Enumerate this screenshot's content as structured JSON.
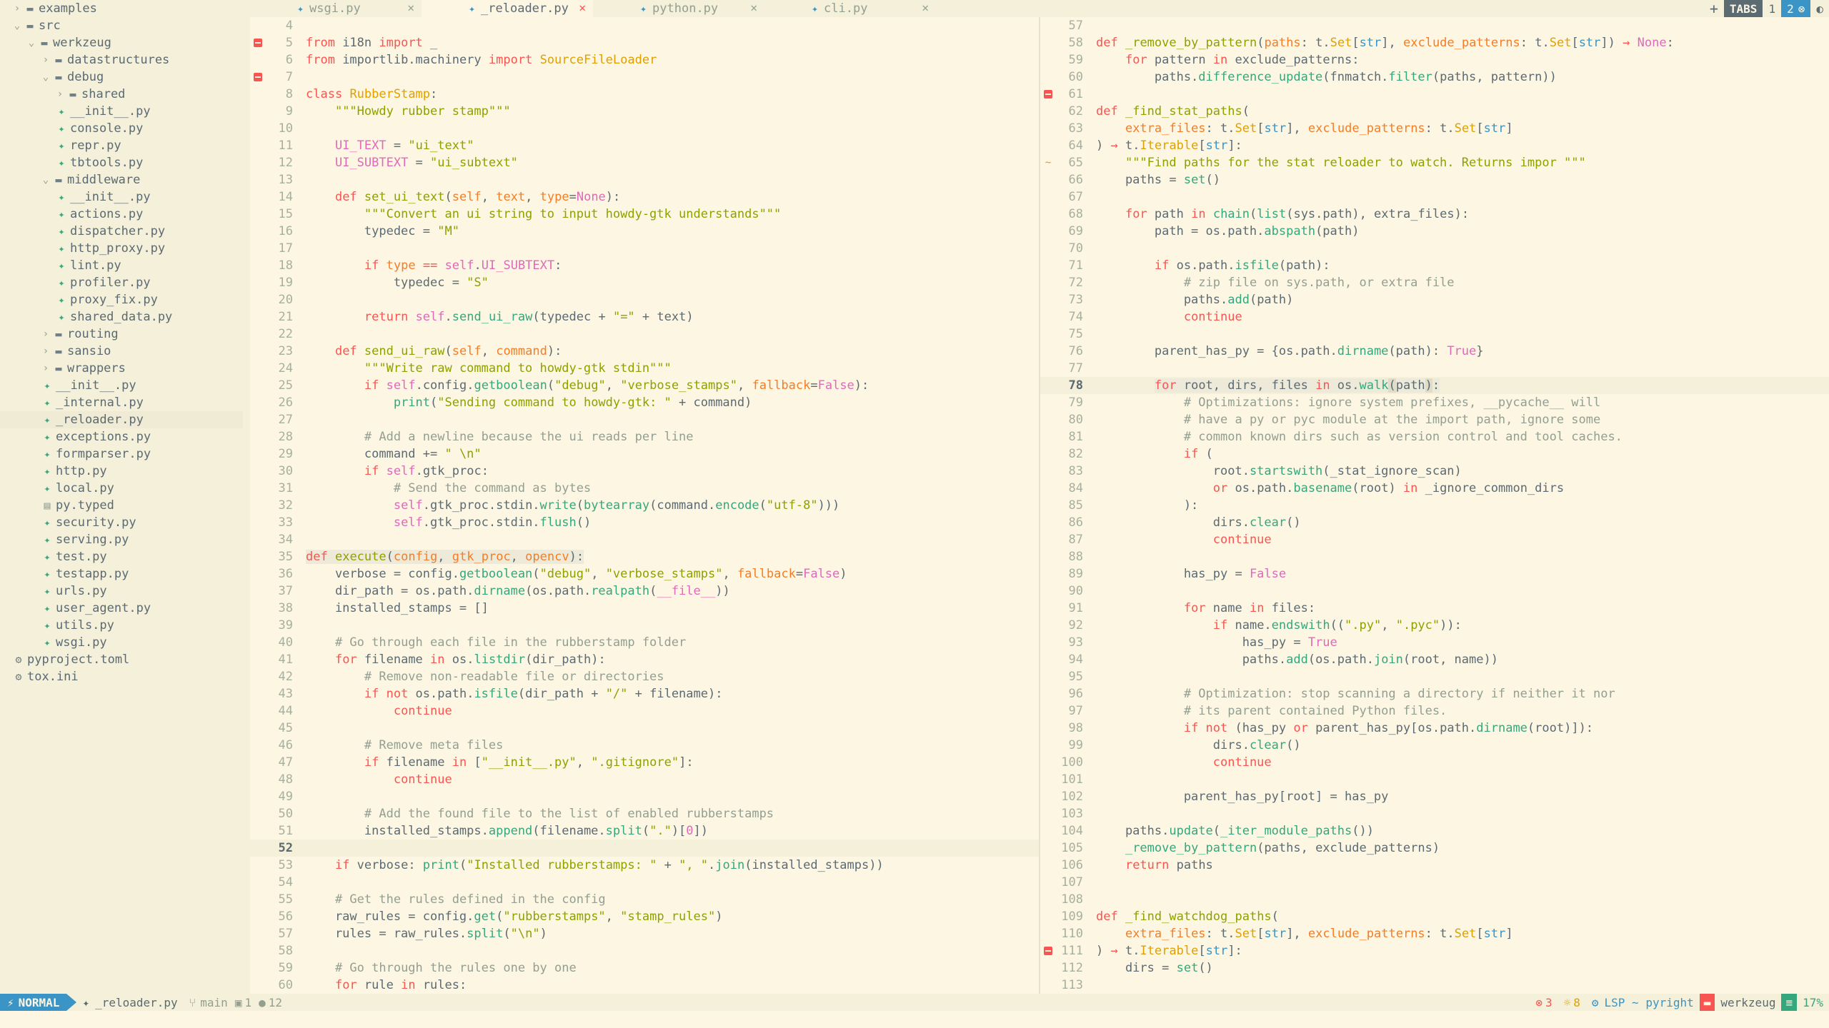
{
  "sidebar": {
    "items": [
      {
        "label": "examples",
        "type": "folder",
        "depth": 0,
        "open": false
      },
      {
        "label": "src",
        "type": "folder",
        "depth": 0,
        "open": true
      },
      {
        "label": "werkzeug",
        "type": "folder",
        "depth": 1,
        "open": true
      },
      {
        "label": "datastructures",
        "type": "folder",
        "depth": 2,
        "open": false
      },
      {
        "label": "debug",
        "type": "folder",
        "depth": 2,
        "open": true
      },
      {
        "label": "shared",
        "type": "folder",
        "depth": 3,
        "open": false
      },
      {
        "label": "__init__.py",
        "type": "py",
        "depth": 3
      },
      {
        "label": "console.py",
        "type": "py",
        "depth": 3
      },
      {
        "label": "repr.py",
        "type": "py",
        "depth": 3
      },
      {
        "label": "tbtools.py",
        "type": "py",
        "depth": 3
      },
      {
        "label": "middleware",
        "type": "folder",
        "depth": 2,
        "open": true
      },
      {
        "label": "__init__.py",
        "type": "py",
        "depth": 3
      },
      {
        "label": "actions.py",
        "type": "py",
        "depth": 3
      },
      {
        "label": "dispatcher.py",
        "type": "py",
        "depth": 3
      },
      {
        "label": "http_proxy.py",
        "type": "py",
        "depth": 3
      },
      {
        "label": "lint.py",
        "type": "py",
        "depth": 3
      },
      {
        "label": "profiler.py",
        "type": "py",
        "depth": 3
      },
      {
        "label": "proxy_fix.py",
        "type": "py",
        "depth": 3
      },
      {
        "label": "shared_data.py",
        "type": "py",
        "depth": 3
      },
      {
        "label": "routing",
        "type": "folder",
        "depth": 2,
        "open": false
      },
      {
        "label": "sansio",
        "type": "folder",
        "depth": 2,
        "open": false
      },
      {
        "label": "wrappers",
        "type": "folder",
        "depth": 2,
        "open": false
      },
      {
        "label": "__init__.py",
        "type": "py",
        "depth": 2
      },
      {
        "label": "_internal.py",
        "type": "py",
        "depth": 2
      },
      {
        "label": "_reloader.py",
        "type": "py",
        "depth": 2,
        "selected": true
      },
      {
        "label": "exceptions.py",
        "type": "py",
        "depth": 2
      },
      {
        "label": "formparser.py",
        "type": "py",
        "depth": 2
      },
      {
        "label": "http.py",
        "type": "py",
        "depth": 2
      },
      {
        "label": "local.py",
        "type": "py",
        "depth": 2
      },
      {
        "label": "py.typed",
        "type": "txt",
        "depth": 2
      },
      {
        "label": "security.py",
        "type": "py",
        "depth": 2
      },
      {
        "label": "serving.py",
        "type": "py",
        "depth": 2
      },
      {
        "label": "test.py",
        "type": "py",
        "depth": 2
      },
      {
        "label": "testapp.py",
        "type": "py",
        "depth": 2
      },
      {
        "label": "urls.py",
        "type": "py",
        "depth": 2
      },
      {
        "label": "user_agent.py",
        "type": "py",
        "depth": 2
      },
      {
        "label": "utils.py",
        "type": "py",
        "depth": 2
      },
      {
        "label": "wsgi.py",
        "type": "py",
        "depth": 2
      },
      {
        "label": "pyproject.toml",
        "type": "cfg",
        "depth": 0
      },
      {
        "label": "tox.ini",
        "type": "cfg",
        "depth": 0
      }
    ]
  },
  "tabs": [
    {
      "label": "wsgi.py",
      "active": false
    },
    {
      "label": "_reloader.py",
      "active": true
    },
    {
      "label": "python.py",
      "active": false
    },
    {
      "label": "cli.py",
      "active": false
    }
  ],
  "tabbar_right": {
    "plus": "+",
    "tabs_label": "TABS",
    "tab1": "1",
    "tab2": "2"
  },
  "icons": {
    "close": "close-icon",
    "python": "python-file-icon",
    "folder": "folder-icon",
    "error_sign": "error-sign-icon"
  },
  "left_pane": {
    "current_line": 52,
    "lines": [
      {
        "n": 4,
        "h": ""
      },
      {
        "n": 5,
        "s": "err",
        "h": "<span class='kw'>from</span> i18n <span class='kw'>import</span> _"
      },
      {
        "n": 6,
        "h": "<span class='kw'>from</span> importlib.machinery <span class='kw'>import</span> <span class='ty'>SourceFileLoader</span>"
      },
      {
        "n": 7,
        "s": "err",
        "h": ""
      },
      {
        "n": 8,
        "h": "<span class='kw'>class</span> <span class='ty'>RubberStamp</span>:"
      },
      {
        "n": 9,
        "h": "    <span class='st'>\"\"\"Howdy rubber stamp\"\"\"</span>"
      },
      {
        "n": 10,
        "h": ""
      },
      {
        "n": 11,
        "h": "    <span class='cn'>UI_TEXT</span> = <span class='st'>\"ui_text\"</span>"
      },
      {
        "n": 12,
        "h": "    <span class='cn'>UI_SUBTEXT</span> = <span class='st'>\"ui_subtext\"</span>"
      },
      {
        "n": 13,
        "h": ""
      },
      {
        "n": 14,
        "h": "    <span class='kw'>def</span> <span class='fd'>set_ui_text</span>(<span class='pr'>self</span>, <span class='pr'>text</span>, <span class='pr'>type</span>=<span class='cn'>None</span>):"
      },
      {
        "n": 15,
        "h": "        <span class='st'>\"\"\"Convert an ui string to input howdy-gtk understands\"\"\"</span>"
      },
      {
        "n": 16,
        "h": "        typedec = <span class='st'>\"M\"</span>"
      },
      {
        "n": 17,
        "h": ""
      },
      {
        "n": 18,
        "h": "        <span class='kw'>if</span> <span class='pr'>type</span> <span class='kw'>==</span> <span class='sf'>self</span>.<span class='cn'>UI_SUBTEXT</span>:"
      },
      {
        "n": 19,
        "h": "            typedec = <span class='st'>\"S\"</span>"
      },
      {
        "n": 20,
        "h": ""
      },
      {
        "n": 21,
        "h": "        <span class='kw'>return</span> <span class='sf'>self</span>.<span class='fn'>send_ui_raw</span>(typedec + <span class='st'>\"=\"</span> + text)"
      },
      {
        "n": 22,
        "h": ""
      },
      {
        "n": 23,
        "h": "    <span class='kw'>def</span> <span class='fd'>send_ui_raw</span>(<span class='pr'>self</span>, <span class='pr'>command</span>):"
      },
      {
        "n": 24,
        "h": "        <span class='st'>\"\"\"Write raw command to howdy-gtk stdin\"\"\"</span>"
      },
      {
        "n": 25,
        "h": "        <span class='kw'>if</span> <span class='sf'>self</span>.config.<span class='fn'>getboolean</span>(<span class='st'>\"debug\"</span>, <span class='st'>\"verbose_stamps\"</span>, <span class='pr'>fallback</span>=<span class='cn'>False</span>):"
      },
      {
        "n": 26,
        "h": "            <span class='fn'>print</span>(<span class='st'>\"Sending command to howdy-gtk: \"</span> + command)"
      },
      {
        "n": 27,
        "h": ""
      },
      {
        "n": 28,
        "h": "        <span class='cm'># Add a newline because the ui reads per line</span>"
      },
      {
        "n": 29,
        "h": "        command += <span class='st'>\" \\n\"</span>"
      },
      {
        "n": 30,
        "h": "        <span class='kw'>if</span> <span class='sf'>self</span>.gtk_proc:"
      },
      {
        "n": 31,
        "h": "            <span class='cm'># Send the command as bytes</span>"
      },
      {
        "n": 32,
        "h": "            <span class='sf'>self</span>.gtk_proc.stdin.<span class='fn'>write</span>(<span class='fn'>bytearray</span>(command.<span class='fn'>encode</span>(<span class='st'>\"utf-8\"</span>)))"
      },
      {
        "n": 33,
        "h": "            <span class='sf'>self</span>.gtk_proc.stdin.<span class='fn'>flush</span>()"
      },
      {
        "n": 34,
        "h": ""
      },
      {
        "n": 35,
        "h": "<span class='hl'><span class='kw'>def</span> <span class='fd'>execute</span>(<span class='pr'>config</span>, <span class='pr'>gtk_proc</span>, <span class='pr'>opencv</span>):</span>"
      },
      {
        "n": 36,
        "h": "    verbose = config.<span class='fn'>getboolean</span>(<span class='st'>\"debug\"</span>, <span class='st'>\"verbose_stamps\"</span>, <span class='pr'>fallback</span>=<span class='cn'>False</span>)"
      },
      {
        "n": 37,
        "h": "    dir_path = os.path.<span class='fn'>dirname</span>(os.path.<span class='fn'>realpath</span>(<span class='cn'>__file__</span>))"
      },
      {
        "n": 38,
        "h": "    installed_stamps = []"
      },
      {
        "n": 39,
        "h": ""
      },
      {
        "n": 40,
        "h": "    <span class='cm'># Go through each file in the rubberstamp folder</span>"
      },
      {
        "n": 41,
        "h": "    <span class='kw'>for</span> filename <span class='kw'>in</span> os.<span class='fn'>listdir</span>(dir_path):"
      },
      {
        "n": 42,
        "h": "        <span class='cm'># Remove non-readable file or directories</span>"
      },
      {
        "n": 43,
        "h": "        <span class='kw'>if not</span> os.path.<span class='fn'>isfile</span>(dir_path + <span class='st'>\"/\"</span> + filename):"
      },
      {
        "n": 44,
        "h": "            <span class='kw'>continue</span>"
      },
      {
        "n": 45,
        "h": ""
      },
      {
        "n": 46,
        "h": "        <span class='cm'># Remove meta files</span>"
      },
      {
        "n": 47,
        "h": "        <span class='kw'>if</span> filename <span class='kw'>in</span> [<span class='st'>\"__init__.py\"</span>, <span class='st'>\".gitignore\"</span>]:"
      },
      {
        "n": 48,
        "h": "            <span class='kw'>continue</span>"
      },
      {
        "n": 49,
        "h": ""
      },
      {
        "n": 50,
        "h": "        <span class='cm'># Add the found file to the list of enabled rubberstamps</span>"
      },
      {
        "n": 51,
        "h": "        installed_stamps.<span class='fn'>append</span>(filename.<span class='fn'>split</span>(<span class='st'>\".\"</span>)[<span class='cn'>0</span>])"
      },
      {
        "n": 52,
        "h": ""
      },
      {
        "n": 53,
        "h": "    <span class='kw'>if</span> verbose: <span class='fn'>print</span>(<span class='st'>\"Installed rubberstamps: \"</span> + <span class='st'>\", \"</span>.<span class='fn'>join</span>(installed_stamps))"
      },
      {
        "n": 54,
        "h": ""
      },
      {
        "n": 55,
        "h": "    <span class='cm'># Get the rules defined in the config</span>"
      },
      {
        "n": 56,
        "h": "    raw_rules = config.<span class='fn'>get</span>(<span class='st'>\"rubberstamps\"</span>, <span class='st'>\"stamp_rules\"</span>)"
      },
      {
        "n": 57,
        "h": "    rules = raw_rules.<span class='fn'>split</span>(<span class='st'>\"\\n\"</span>)"
      },
      {
        "n": 58,
        "h": ""
      },
      {
        "n": 59,
        "h": "    <span class='cm'># Go through the rules one by one</span>"
      },
      {
        "n": 60,
        "h": "    <span class='kw'>for</span> rule <span class='kw'>in</span> rules:"
      }
    ]
  },
  "right_pane": {
    "current_line": 78,
    "lines": [
      {
        "n": 57,
        "h": ""
      },
      {
        "n": 58,
        "h": "<span class='kw'>def</span> <span class='fd'>_remove_by_pattern</span>(<span class='pr'>paths</span>: t.<span class='ty'>Set</span>[<span class='bi'>str</span>], <span class='pr'>exclude_patterns</span>: t.<span class='ty'>Set</span>[<span class='bi'>str</span>]) <span class='kw'>→</span> <span class='cn'>None</span>:"
      },
      {
        "n": 59,
        "h": "    <span class='kw'>for</span> pattern <span class='kw'>in</span> exclude_patterns:"
      },
      {
        "n": 60,
        "h": "        paths.<span class='fn'>difference_update</span>(fnmatch.<span class='fn'>filter</span>(paths, pattern))"
      },
      {
        "n": 61,
        "s": "err",
        "h": ""
      },
      {
        "n": 62,
        "h": "<span class='kw'>def</span> <span class='fd'>_find_stat_paths</span>("
      },
      {
        "n": 63,
        "h": "    <span class='pr'>extra_files</span>: t.<span class='ty'>Set</span>[<span class='bi'>str</span>], <span class='pr'>exclude_patterns</span>: t.<span class='ty'>Set</span>[<span class='bi'>str</span>]"
      },
      {
        "n": 64,
        "h": ") <span class='kw'>→</span> t.<span class='ty'>Iterable</span>[<span class='bi'>str</span>]:"
      },
      {
        "n": 65,
        "s": "mod",
        "h": "    <span class='st'>\"\"\"Find paths for the stat reloader to watch. Returns impor \"\"\"</span>"
      },
      {
        "n": 66,
        "h": "    paths = <span class='fn'>set</span>()"
      },
      {
        "n": 67,
        "h": ""
      },
      {
        "n": 68,
        "h": "    <span class='kw'>for</span> path <span class='kw'>in</span> <span class='fn'>chain</span>(<span class='fn'>list</span>(sys.path), extra_files):"
      },
      {
        "n": 69,
        "h": "        path = os.path.<span class='fn'>abspath</span>(path)"
      },
      {
        "n": 70,
        "h": ""
      },
      {
        "n": 71,
        "h": "        <span class='kw'>if</span> os.path.<span class='fn'>isfile</span>(path):"
      },
      {
        "n": 72,
        "h": "            <span class='cm'># zip file on sys.path, or extra file</span>"
      },
      {
        "n": 73,
        "h": "            paths.<span class='fn'>add</span>(path)"
      },
      {
        "n": 74,
        "h": "            <span class='kw'>continue</span>"
      },
      {
        "n": 75,
        "h": ""
      },
      {
        "n": 76,
        "h": "        parent_has_py = {os.path.<span class='fn'>dirname</span>(path): <span class='cn'>True</span>}"
      },
      {
        "n": 77,
        "h": ""
      },
      {
        "n": 78,
        "h": "        <span class='hl'><span class='kw'>for</span> root, dirs, files <span class='kw'>in</span> os.<span class='fn'>walk</span><span class='sel'>(</span>path<span class='sel'>)</span>:</span>"
      },
      {
        "n": 79,
        "h": "            <span class='cm'># Optimizations: ignore system prefixes, __pycache__ will</span>"
      },
      {
        "n": 80,
        "h": "            <span class='cm'># have a py or pyc module at the import path, ignore some</span>"
      },
      {
        "n": 81,
        "h": "            <span class='cm'># common known dirs such as version control and tool caches.</span>"
      },
      {
        "n": 82,
        "h": "            <span class='kw'>if</span> ("
      },
      {
        "n": 83,
        "h": "                root.<span class='fn'>startswith</span>(_stat_ignore_scan)"
      },
      {
        "n": 84,
        "h": "                <span class='kw'>or</span> os.path.<span class='fn'>basename</span>(root) <span class='kw'>in</span> _ignore_common_dirs"
      },
      {
        "n": 85,
        "h": "            ):"
      },
      {
        "n": 86,
        "h": "                dirs.<span class='fn'>clear</span>()"
      },
      {
        "n": 87,
        "h": "                <span class='kw'>continue</span>"
      },
      {
        "n": 88,
        "h": ""
      },
      {
        "n": 89,
        "h": "            has_py = <span class='cn'>False</span>"
      },
      {
        "n": 90,
        "h": ""
      },
      {
        "n": 91,
        "h": "            <span class='kw'>for</span> name <span class='kw'>in</span> files:"
      },
      {
        "n": 92,
        "h": "                <span class='kw'>if</span> name.<span class='fn'>endswith</span>((<span class='st'>\".py\"</span>, <span class='st'>\".pyc\"</span>)):"
      },
      {
        "n": 93,
        "h": "                    has_py = <span class='cn'>True</span>"
      },
      {
        "n": 94,
        "h": "                    paths.<span class='fn'>add</span>(os.path.<span class='fn'>join</span>(root, name))"
      },
      {
        "n": 95,
        "h": ""
      },
      {
        "n": 96,
        "h": "            <span class='cm'># Optimization: stop scanning a directory if neither it nor</span>"
      },
      {
        "n": 97,
        "h": "            <span class='cm'># its parent contained Python files.</span>"
      },
      {
        "n": 98,
        "h": "            <span class='kw'>if not</span> (has_py <span class='kw'>or</span> parent_has_py[os.path.<span class='fn'>dirname</span>(root)]):"
      },
      {
        "n": 99,
        "h": "                dirs.<span class='fn'>clear</span>()"
      },
      {
        "n": 100,
        "h": "                <span class='kw'>continue</span>"
      },
      {
        "n": 101,
        "h": ""
      },
      {
        "n": 102,
        "h": "            parent_has_py[root] = has_py"
      },
      {
        "n": 103,
        "h": ""
      },
      {
        "n": 104,
        "h": "    paths.<span class='fn'>update</span>(<span class='fn'>_iter_module_paths</span>())"
      },
      {
        "n": 105,
        "h": "    <span class='fn'>_remove_by_pattern</span>(paths, exclude_patterns)"
      },
      {
        "n": 106,
        "h": "    <span class='kw'>return</span> paths"
      },
      {
        "n": 107,
        "h": ""
      },
      {
        "n": 108,
        "h": ""
      },
      {
        "n": 109,
        "h": "<span class='kw'>def</span> <span class='fd'>_find_watchdog_paths</span>("
      },
      {
        "n": 110,
        "h": "    <span class='pr'>extra_files</span>: t.<span class='ty'>Set</span>[<span class='bi'>str</span>], <span class='pr'>exclude_patterns</span>: t.<span class='ty'>Set</span>[<span class='bi'>str</span>]"
      },
      {
        "n": 111,
        "s": "err",
        "h": ") <span class='kw'>→</span> t.<span class='ty'>Iterable</span>[<span class='bi'>str</span>]:"
      },
      {
        "n": 112,
        "h": "    dirs = <span class='fn'>set</span>()"
      },
      {
        "n": 113,
        "h": ""
      }
    ]
  },
  "statusbar": {
    "mode": "NORMAL",
    "file": "_reloader.py",
    "branch": "main",
    "count1": "1",
    "count2": "12",
    "errors": "3",
    "hints": "8",
    "lsp": "LSP ~ pyright",
    "project": "werkzeug",
    "percent": "17%"
  },
  "colors": {
    "accent": "#3a94c5",
    "error": "#f85552",
    "background": "#fdf6e3"
  }
}
